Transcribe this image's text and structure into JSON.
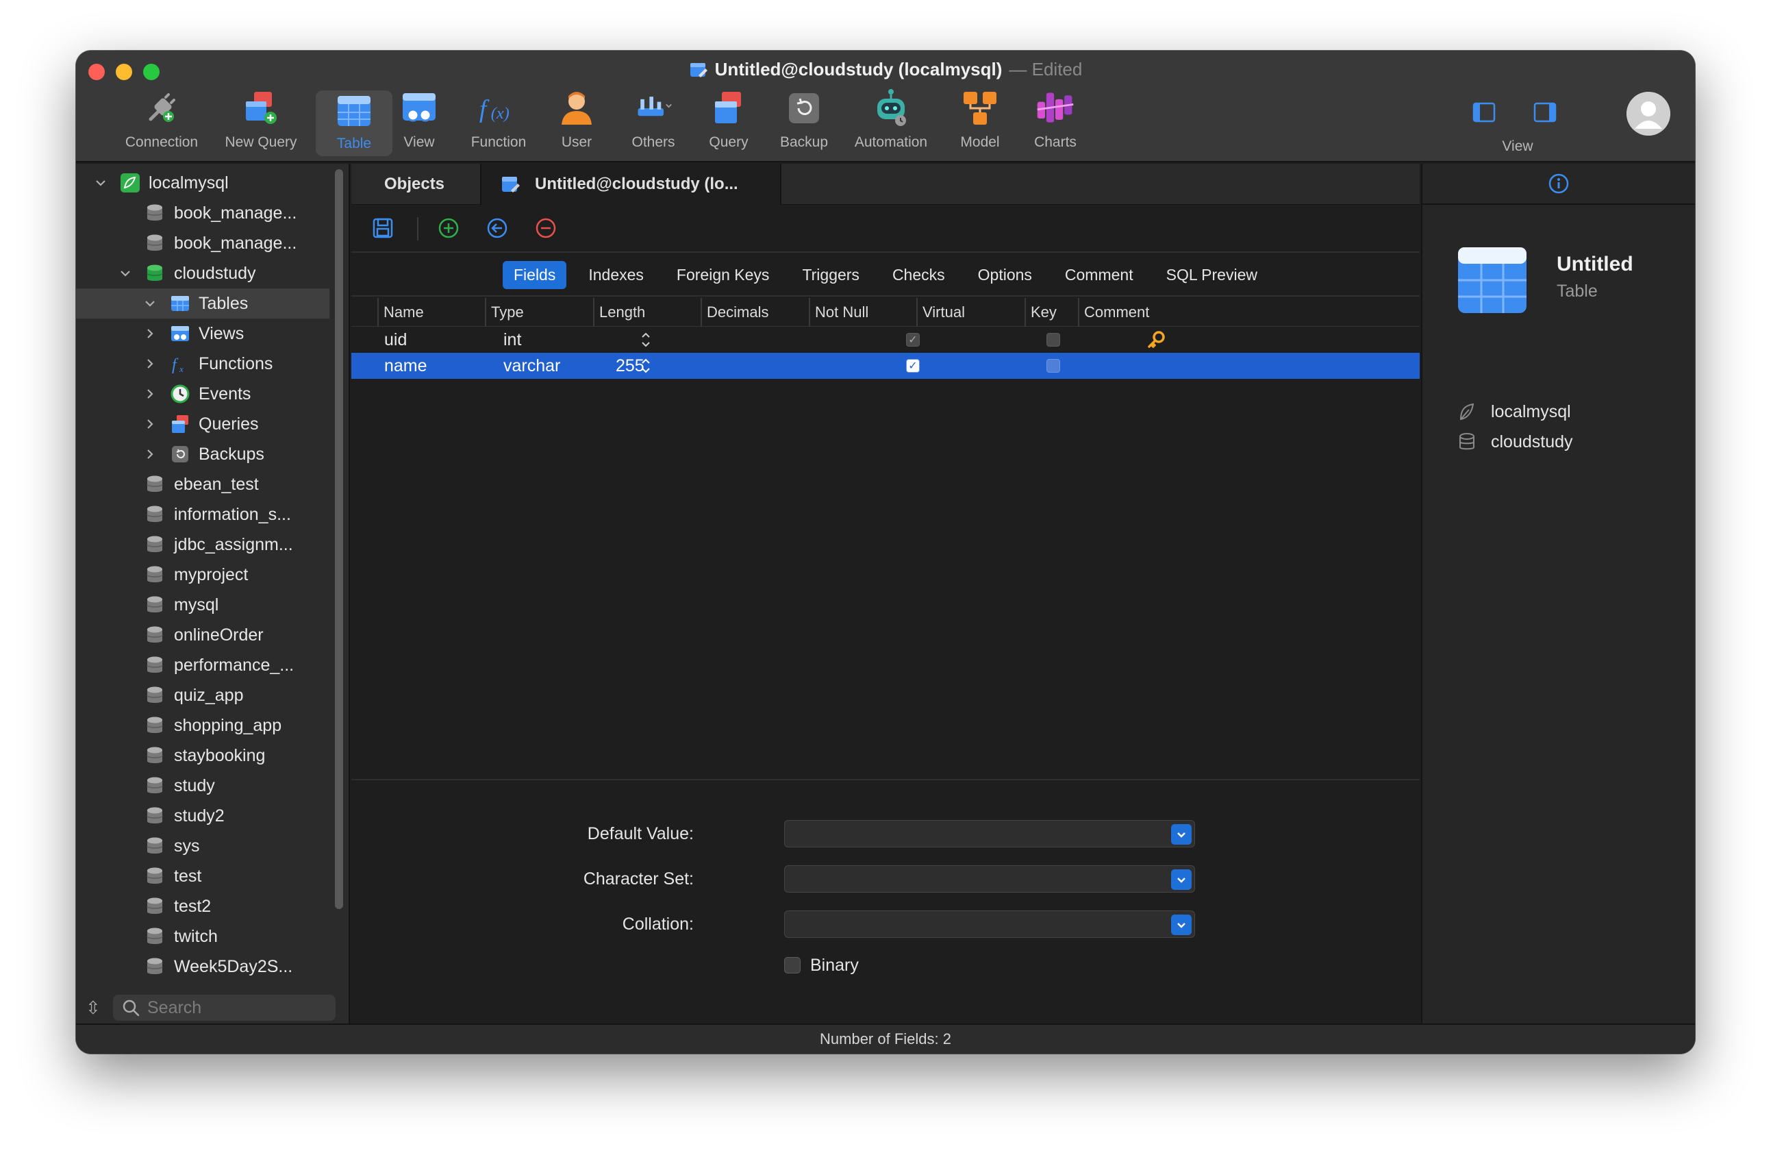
{
  "window": {
    "title": "Untitled@cloudstudy (localmysql)",
    "title_suffix": "— Edited"
  },
  "toolbar": {
    "items": [
      {
        "label": "Connection",
        "icon": "connection-plug-icon"
      },
      {
        "label": "New Query",
        "icon": "new-query-icon"
      },
      {
        "label": "Table",
        "icon": "table-icon",
        "active": true
      },
      {
        "label": "View",
        "icon": "view-icon"
      },
      {
        "label": "Function",
        "icon": "function-fx-icon"
      },
      {
        "label": "User",
        "icon": "user-icon"
      },
      {
        "label": "Others",
        "icon": "others-tools-icon"
      },
      {
        "label": "Query",
        "icon": "query-icon"
      },
      {
        "label": "Backup",
        "icon": "backup-icon"
      },
      {
        "label": "Automation",
        "icon": "automation-robot-icon"
      },
      {
        "label": "Model",
        "icon": "model-icon"
      },
      {
        "label": "Charts",
        "icon": "charts-icon"
      }
    ],
    "view_label": "View"
  },
  "sidebar": {
    "tree": [
      {
        "label": "localmysql",
        "level": 0,
        "expanded": true,
        "icon": "mysql-connection-icon"
      },
      {
        "label": "book_manage...",
        "level": 1,
        "icon": "database-icon"
      },
      {
        "label": "book_manage...",
        "level": 1,
        "icon": "database-icon"
      },
      {
        "label": "cloudstudy",
        "level": 1,
        "expanded": true,
        "icon": "database-open-icon"
      },
      {
        "label": "Tables",
        "level": 2,
        "expanded": true,
        "icon": "tables-icon",
        "selected": true
      },
      {
        "label": "Views",
        "level": 2,
        "expanded": false,
        "icon": "views-icon"
      },
      {
        "label": "Functions",
        "level": 2,
        "expanded": false,
        "icon": "functions-icon"
      },
      {
        "label": "Events",
        "level": 2,
        "expanded": false,
        "icon": "events-clock-icon"
      },
      {
        "label": "Queries",
        "level": 2,
        "expanded": false,
        "icon": "queries-icon"
      },
      {
        "label": "Backups",
        "level": 2,
        "expanded": false,
        "icon": "backups-icon"
      },
      {
        "label": "ebean_test",
        "level": 1,
        "icon": "database-icon"
      },
      {
        "label": "information_s...",
        "level": 1,
        "icon": "database-icon"
      },
      {
        "label": "jdbc_assignm...",
        "level": 1,
        "icon": "database-icon"
      },
      {
        "label": "myproject",
        "level": 1,
        "icon": "database-icon"
      },
      {
        "label": "mysql",
        "level": 1,
        "icon": "database-icon"
      },
      {
        "label": "onlineOrder",
        "level": 1,
        "icon": "database-icon"
      },
      {
        "label": "performance_...",
        "level": 1,
        "icon": "database-icon"
      },
      {
        "label": "quiz_app",
        "level": 1,
        "icon": "database-icon"
      },
      {
        "label": "shopping_app",
        "level": 1,
        "icon": "database-icon"
      },
      {
        "label": "staybooking",
        "level": 1,
        "icon": "database-icon"
      },
      {
        "label": "study",
        "level": 1,
        "icon": "database-icon"
      },
      {
        "label": "study2",
        "level": 1,
        "icon": "database-icon"
      },
      {
        "label": "sys",
        "level": 1,
        "icon": "database-icon"
      },
      {
        "label": "test",
        "level": 1,
        "icon": "database-icon"
      },
      {
        "label": "test2",
        "level": 1,
        "icon": "database-icon"
      },
      {
        "label": "twitch",
        "level": 1,
        "icon": "database-icon"
      },
      {
        "label": "Week5Day2S...",
        "level": 1,
        "icon": "database-icon"
      }
    ],
    "search_placeholder": "Search"
  },
  "tabs": {
    "objects": "Objects",
    "document": "Untitled@cloudstudy (lo..."
  },
  "subtabs": [
    "Fields",
    "Indexes",
    "Foreign Keys",
    "Triggers",
    "Checks",
    "Options",
    "Comment",
    "SQL Preview"
  ],
  "active_subtab": "Fields",
  "grid": {
    "columns": [
      "Name",
      "Type",
      "Length",
      "Decimals",
      "Not Null",
      "Virtual",
      "Key",
      "Comment"
    ],
    "rows": [
      {
        "name": "uid",
        "type": "int",
        "length": "",
        "decimals": "",
        "not_null": true,
        "virtual": false,
        "key": true,
        "comment": "",
        "selected": false
      },
      {
        "name": "name",
        "type": "varchar",
        "length": "255",
        "decimals": "",
        "not_null": true,
        "virtual": false,
        "key": false,
        "comment": "",
        "selected": true
      }
    ]
  },
  "properties": {
    "default_value_label": "Default Value:",
    "default_value": "",
    "character_set_label": "Character Set:",
    "character_set": "",
    "collation_label": "Collation:",
    "collation": "",
    "binary_label": "Binary",
    "binary": false
  },
  "inspector": {
    "title": "Untitled",
    "subtitle": "Table",
    "connection": "localmysql",
    "database": "cloudstudy"
  },
  "status": {
    "text": "Number of Fields: 2"
  },
  "colors": {
    "accent": "#1f6fd8",
    "selection": "#1f5fd0",
    "key_icon": "#f5a623"
  }
}
